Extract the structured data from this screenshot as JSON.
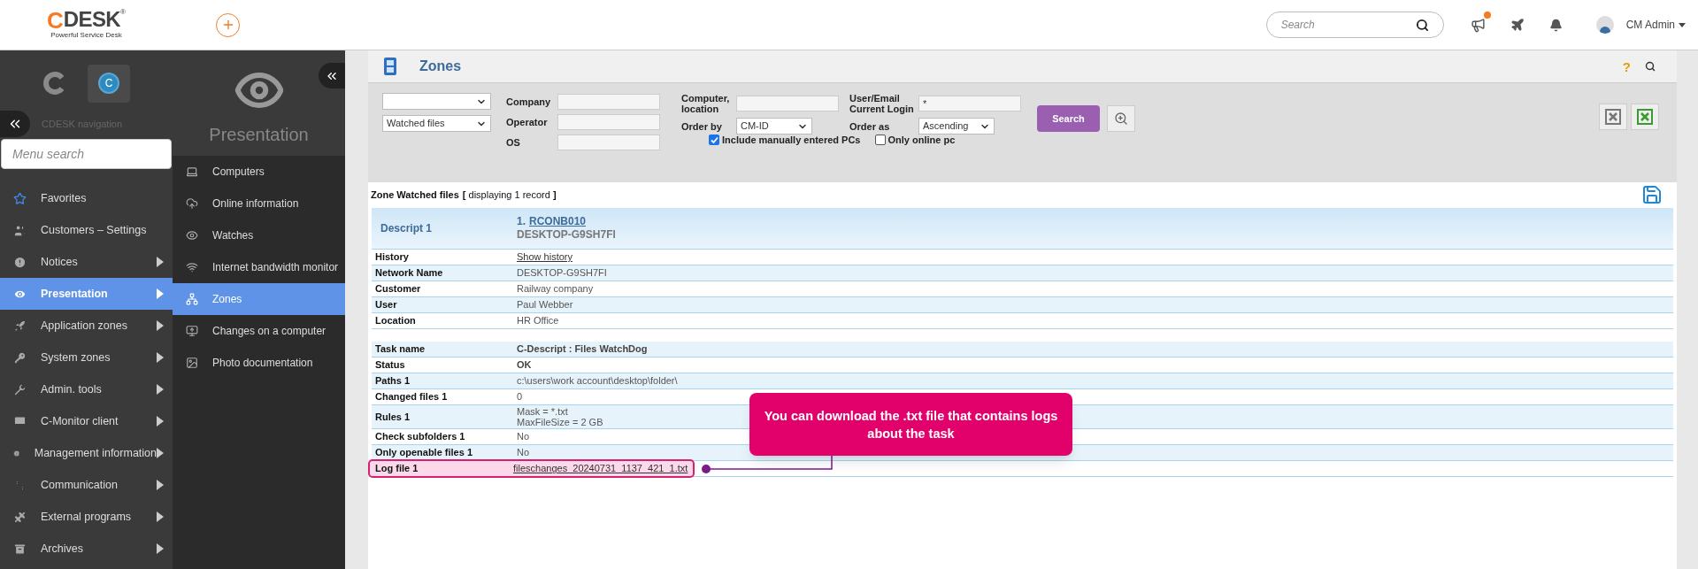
{
  "header": {
    "logo": {
      "mark": "C",
      "name": "DESK",
      "registered": "®",
      "tagline": "Powerful Service Desk"
    },
    "search": {
      "placeholder": "Search"
    },
    "announcements": {
      "unread": true
    },
    "user": {
      "name": "CM Admin"
    }
  },
  "navigation": {
    "app_badge": "C",
    "title": "CDESK navigation",
    "search": {
      "placeholder": "Menu search"
    },
    "items": [
      {
        "label": "Favorites",
        "has_submenu": false,
        "selected": false
      },
      {
        "label": "Customers – Settings",
        "has_submenu": false,
        "selected": false
      },
      {
        "label": "Notices",
        "has_submenu": true,
        "selected": false
      },
      {
        "label": "Presentation",
        "has_submenu": true,
        "selected": true
      },
      {
        "label": "Application zones",
        "has_submenu": true,
        "selected": false
      },
      {
        "label": "System zones",
        "has_submenu": true,
        "selected": false
      },
      {
        "label": "Admin. tools",
        "has_submenu": true,
        "selected": false
      },
      {
        "label": "C-Monitor client",
        "has_submenu": true,
        "selected": false
      },
      {
        "label": "Management information",
        "has_submenu": true,
        "selected": false
      },
      {
        "label": "Communication",
        "has_submenu": true,
        "selected": false
      },
      {
        "label": "External programs",
        "has_submenu": true,
        "selected": false
      },
      {
        "label": "Archives",
        "has_submenu": true,
        "selected": false
      }
    ]
  },
  "submenu": {
    "title": "Presentation",
    "items": [
      {
        "label": "Computers",
        "selected": false
      },
      {
        "label": "Online information",
        "selected": false
      },
      {
        "label": "Watches",
        "selected": false
      },
      {
        "label": "Internet bandwidth monitor",
        "selected": false
      },
      {
        "label": "Zones",
        "selected": true
      },
      {
        "label": "Changes on a computer",
        "selected": false
      },
      {
        "label": "Photo documentation",
        "selected": false
      }
    ]
  },
  "page": {
    "title": "Zones",
    "help": "?",
    "filters": {
      "zone_select": {
        "value": "Watched files"
      },
      "fields": [
        {
          "label": "Company"
        },
        {
          "label": "Operator"
        },
        {
          "label": "OS"
        },
        {
          "label": "Computer, location"
        },
        {
          "label": "User/Email Current Login",
          "value": "*"
        }
      ],
      "order_by": {
        "label": "Order by",
        "value": "CM-ID"
      },
      "order_as": {
        "label": "Order as",
        "value": "Ascending"
      },
      "checkboxes": [
        {
          "label": "Include manually entered PCs",
          "checked": true
        },
        {
          "label": "Only online pc",
          "checked": false
        }
      ],
      "search_button": "Search"
    },
    "results": {
      "heading": "Zone Watched files",
      "count": "**[** displaying 1 record **]**",
      "record": {
        "label": "Descript 1",
        "number": "1.",
        "link": "RCONB010",
        "subtitle": "DESKTOP-G9SH7FI",
        "groups": [
          [
            {
              "label": "History",
              "value": "Show history",
              "kind": "link",
              "highlighted": false
            },
            {
              "label": "Network Name",
              "value": "DESKTOP-G9SH7FI",
              "kind": "text",
              "highlighted": false
            },
            {
              "label": "Customer",
              "value": "Railway company",
              "kind": "text",
              "highlighted": false
            },
            {
              "label": "User",
              "value": "Paul Webber",
              "kind": "text",
              "highlighted": false
            },
            {
              "label": "Location",
              "value": "HR Office",
              "kind": "text",
              "highlighted": false
            }
          ],
          [
            {
              "label": "Task name",
              "value": "C-Descript : Files WatchDog",
              "kind": "bold",
              "highlighted": false
            },
            {
              "label": "Status",
              "value": "OK",
              "kind": "bold",
              "highlighted": false
            },
            {
              "label": "Paths 1",
              "value": "c:\\users\\work account\\desktop\\folder\\",
              "kind": "text",
              "highlighted": false
            },
            {
              "label": "Changed files 1",
              "value": "0",
              "kind": "text",
              "highlighted": false
            },
            {
              "label": "Rules 1",
              "lines": [
                "Mask = *.txt",
                "MaxFileSize = 2 GB"
              ],
              "kind": "lines",
              "highlighted": false
            },
            {
              "label": "Check subfolders 1",
              "value": "No",
              "kind": "text",
              "highlighted": false
            },
            {
              "label": "Only openable files 1",
              "value": "No",
              "kind": "text",
              "highlighted": false
            },
            {
              "label": "Log file 1",
              "value": "fileschanges_20240731_1137_421_1.txt",
              "kind": "link",
              "highlighted": true
            }
          ]
        ]
      }
    },
    "callout": {
      "text": "You can download the .txt file that contains logs about the task"
    }
  }
}
